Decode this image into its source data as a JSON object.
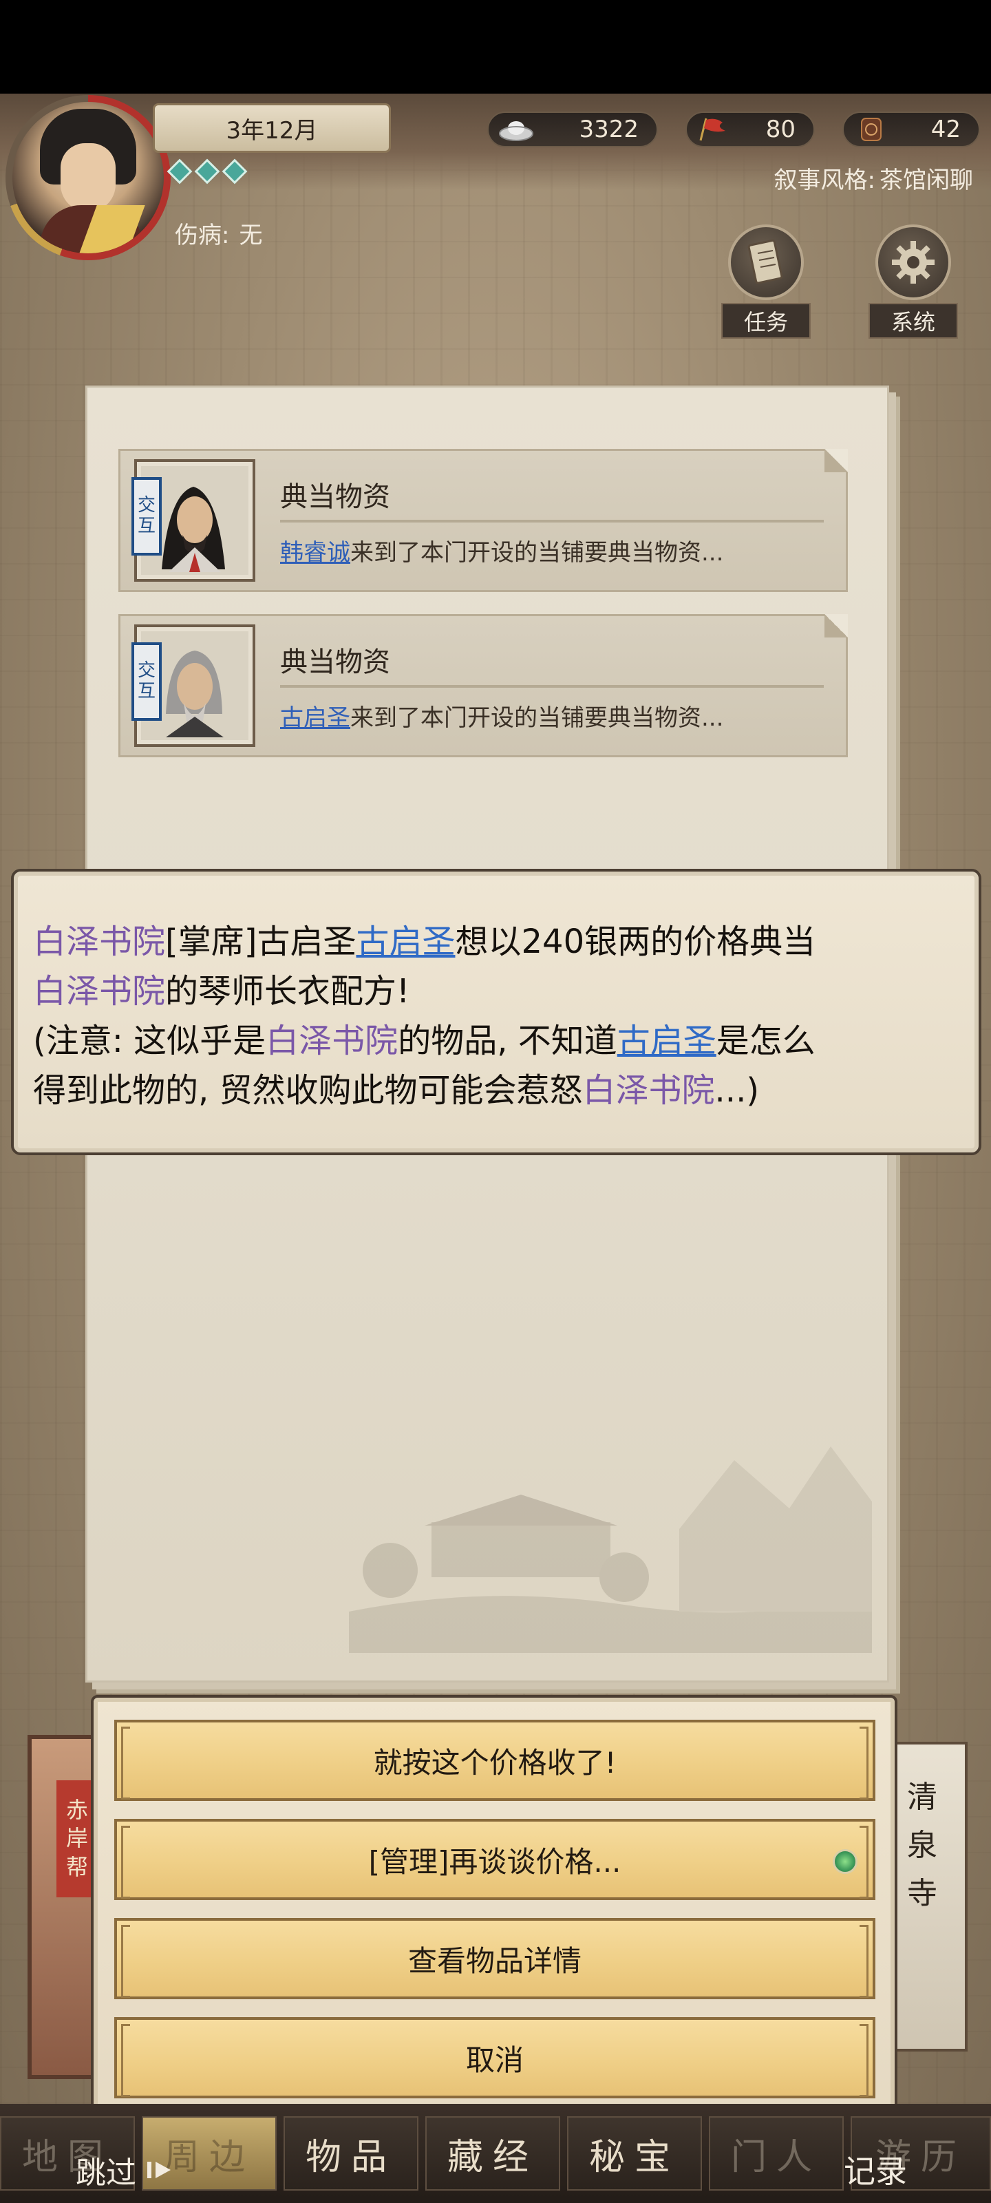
{
  "header": {
    "date": "3年12月",
    "injury_label": "伤病:",
    "injury_value": "无",
    "resources": {
      "silver": "3322",
      "flag": "80",
      "token": "42"
    },
    "style_label": "叙事风格:",
    "style_value": "茶馆闲聊",
    "buttons": {
      "task": "任务",
      "system": "系统"
    }
  },
  "events": [
    {
      "tag": [
        "交",
        "互"
      ],
      "title": "典当物资",
      "name": "韩睿诚",
      "desc": "来到了本门开设的当铺要典当物资..."
    },
    {
      "tag": [
        "交",
        "互"
      ],
      "title": "典当物资",
      "name": "古启圣",
      "desc": "来到了本门开设的当铺要典当物资..."
    }
  ],
  "dialog": {
    "l1_sect": "白泽书院",
    "l1_role": "[掌席]古启圣",
    "l1_name": "古启圣",
    "l1_rest": "想以240银两的价格典当",
    "l2_sect": "白泽书院",
    "l2_rest": "的琴师长衣配方!",
    "l3_a": "(注意: 这似乎是",
    "l3_sect": "白泽书院",
    "l3_b": "的物品, 不知道",
    "l3_name": "古启圣",
    "l3_c": "是怎么",
    "l4_a": "得到此物的, 贸然收购此物可能会惹怒",
    "l4_sect": "白泽书院",
    "l4_b": "...)"
  },
  "side": {
    "left_sign": [
      "赤",
      "岸",
      "帮"
    ],
    "right_sign": [
      "清",
      "泉",
      "寺"
    ]
  },
  "options": [
    "就按这个价格收了!",
    "[管理]再谈谈价格...",
    "查看物品详情",
    "取消"
  ],
  "tabs": {
    "map": "地图",
    "nearby": "周边",
    "items": "物品",
    "scripture": "藏经",
    "treasure": "秘宝",
    "disciples": "门人",
    "history": "游历",
    "skip": "跳过",
    "record": "记录"
  },
  "colors": {
    "sect_purple": "#7a57a8",
    "name_blue": "#2f6ac6",
    "option_gold": "#efcf87"
  }
}
